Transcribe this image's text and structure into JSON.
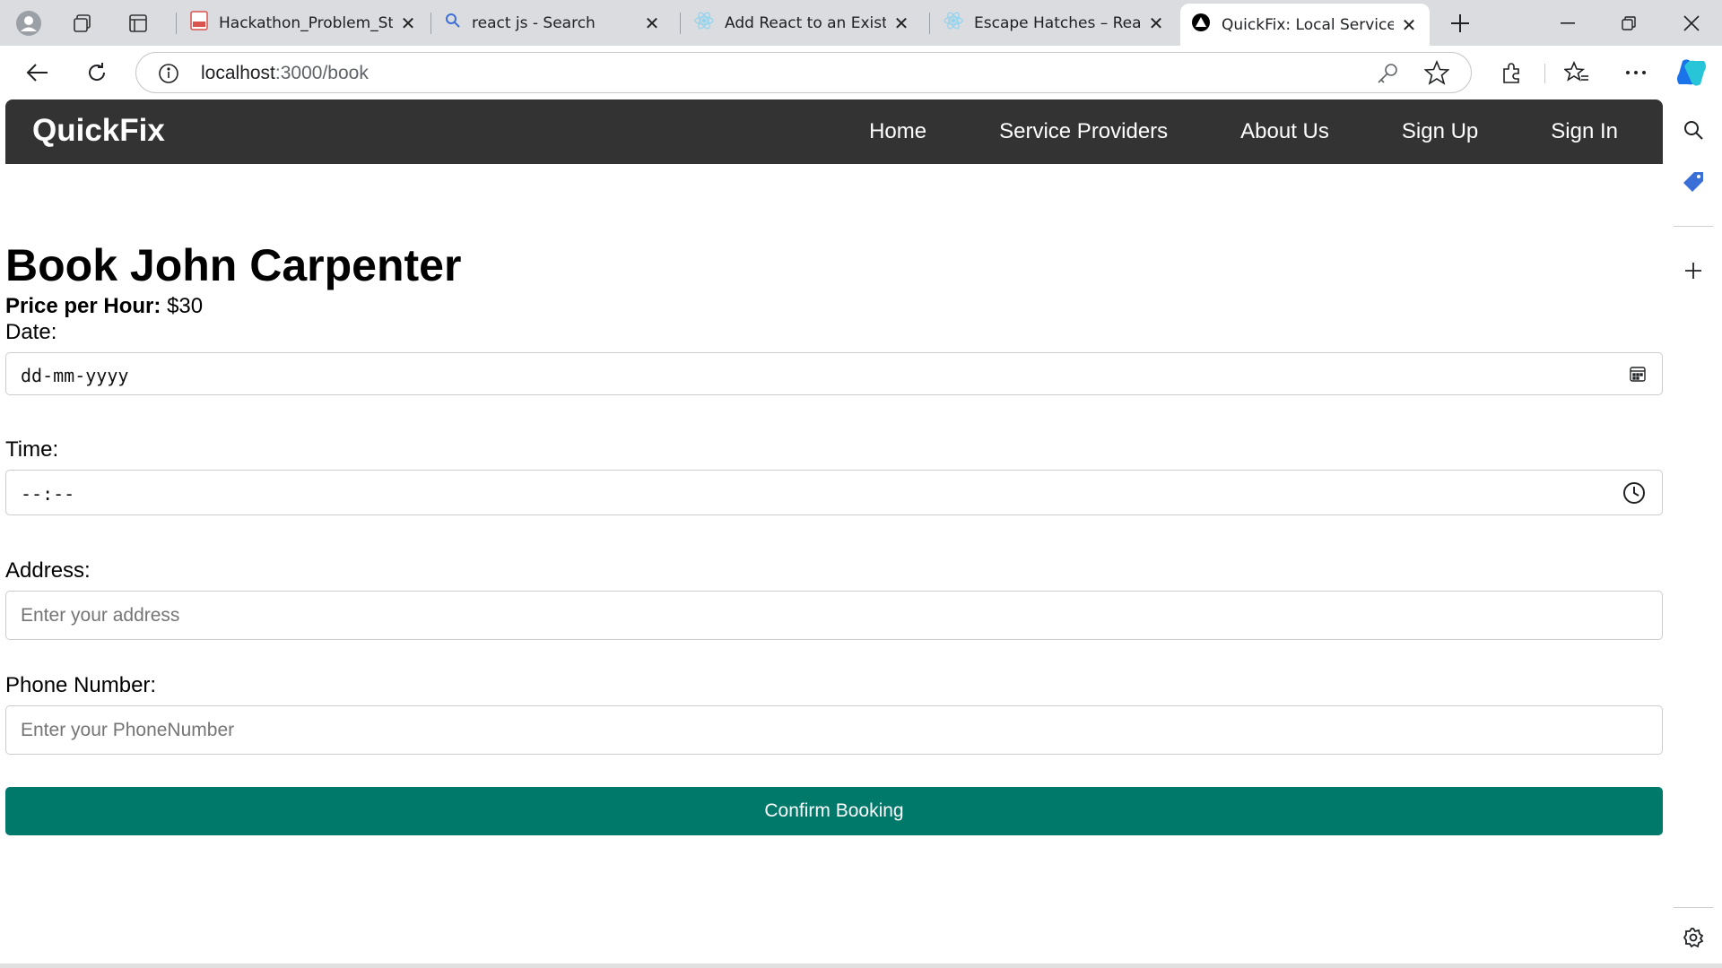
{
  "browser": {
    "tabs": [
      {
        "title": "Hackathon_Problem_Sta",
        "icon": "pdf-icon"
      },
      {
        "title": "react js - Search",
        "icon": "search-icon"
      },
      {
        "title": "Add React to an Existing",
        "icon": "react-icon"
      },
      {
        "title": "Escape Hatches – React",
        "icon": "react-icon"
      },
      {
        "title": "QuickFix: Local Service P",
        "icon": "quickfix-icon"
      }
    ],
    "url_host": "localhost",
    "url_path": ":3000/book"
  },
  "site": {
    "brand": "QuickFix",
    "nav": [
      "Home",
      "Service Providers",
      "About Us",
      "Sign Up",
      "Sign In"
    ]
  },
  "booking": {
    "title": "Book John Carpenter",
    "price_label": "Price per Hour:",
    "price_value": "$30",
    "date_label": "Date:",
    "date_value": "dd-mm-yyyy",
    "time_label": "Time:",
    "time_value": "--:--",
    "address_label": "Address:",
    "address_placeholder": "Enter your address",
    "phone_label": "Phone Number:",
    "phone_placeholder": "Enter your PhoneNumber",
    "confirm_label": "Confirm Booking"
  },
  "colors": {
    "navbar": "#333333",
    "confirm_button": "#00796b"
  }
}
